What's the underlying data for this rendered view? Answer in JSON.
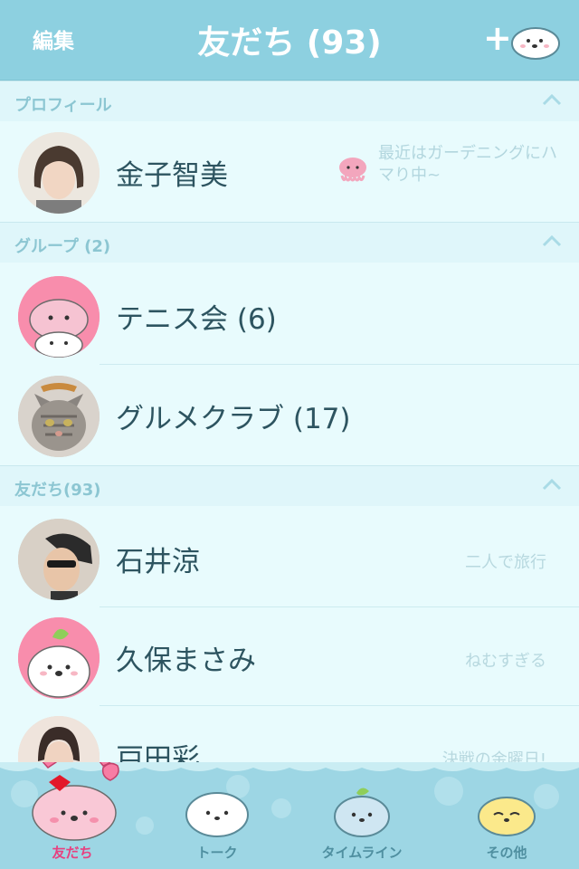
{
  "header": {
    "edit_label": "編集",
    "title": "友だち (93)",
    "add_label": "+"
  },
  "sections": {
    "profile": {
      "label": "プロフィール"
    },
    "groups": {
      "label": "グループ (2)"
    },
    "friends": {
      "label": "友だち(93)"
    }
  },
  "profile": {
    "name": "金子智美",
    "status": "最近はガーデニングにハマり中~"
  },
  "groups": [
    {
      "name": "テニス会 (6)"
    },
    {
      "name": "グルメクラブ (17)"
    }
  ],
  "friends": [
    {
      "name": "石井涼",
      "status": "二人で旅行"
    },
    {
      "name": "久保まさみ",
      "status": "ねむすぎる"
    },
    {
      "name": "戸田彩",
      "status": "決戦の金曜日!"
    }
  ],
  "tabs": [
    {
      "label": "友だち",
      "active": true
    },
    {
      "label": "トーク",
      "active": false
    },
    {
      "label": "タイムライン",
      "active": false
    },
    {
      "label": "その他",
      "active": false
    }
  ],
  "colors": {
    "header_bg": "#8dd0e0",
    "list_bg": "#e8fbfd",
    "active_tab": "#e8407f",
    "name_text": "#2d5460"
  }
}
